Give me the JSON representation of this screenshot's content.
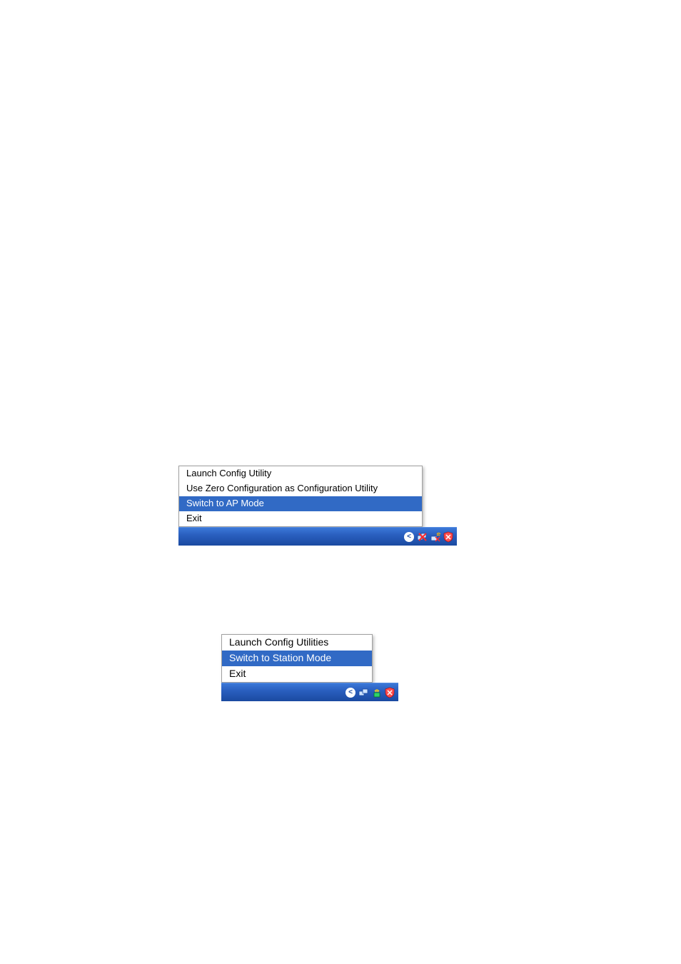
{
  "menu1": {
    "items": [
      {
        "label": "Launch Config Utility",
        "selected": false
      },
      {
        "label": "Use Zero Configuration as Configuration Utility",
        "selected": false
      },
      {
        "label": "Switch to AP Mode",
        "selected": true
      },
      {
        "label": "Exit",
        "selected": false
      }
    ],
    "tray": {
      "chevron": "<",
      "icons": [
        "network-disconnected-icon",
        "wireless-icon",
        "shield-icon"
      ]
    }
  },
  "menu2": {
    "items": [
      {
        "label": "Launch Config Utilities",
        "selected": false
      },
      {
        "label": "Switch to Station Mode",
        "selected": true
      },
      {
        "label": "Exit",
        "selected": false
      }
    ],
    "tray": {
      "chevron": "<",
      "icons": [
        "network-icon",
        "wireless-ap-icon",
        "shield-icon"
      ]
    }
  }
}
